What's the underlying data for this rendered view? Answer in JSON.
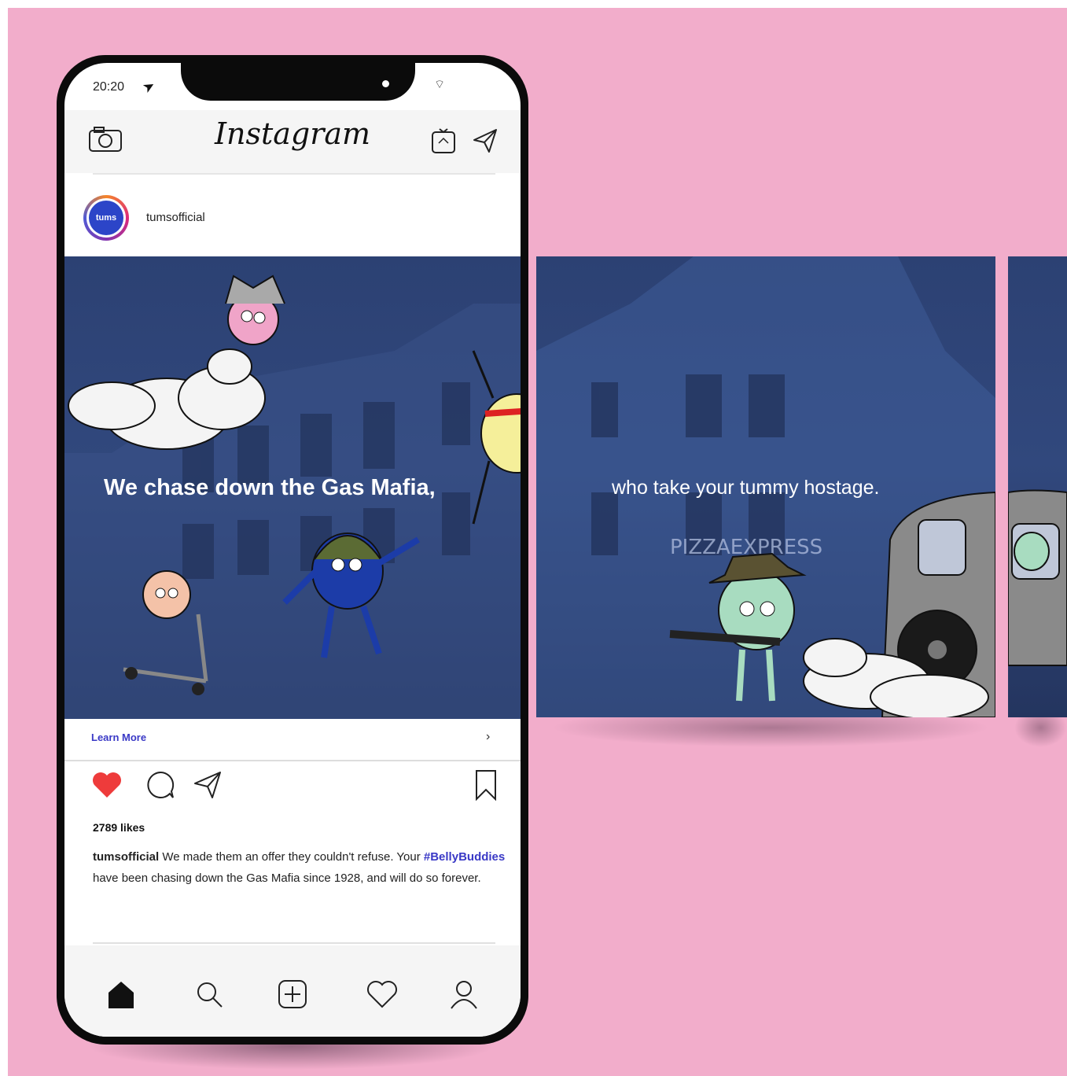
{
  "status_bar": {
    "time": "20:20"
  },
  "header": {
    "logo": "Instagram"
  },
  "post": {
    "username": "tumsofficial",
    "avatar_text": "tums",
    "slide1_caption": "We chase down the Gas Mafia,",
    "learn_more": "Learn More",
    "likes": "2789 likes",
    "caption_user": "tumsofficial",
    "caption_part1": " We made them an offer they couldn't refuse. Your ",
    "caption_hashtag": "#BellyBuddies",
    "caption_part2": " have been chasing down the Gas Mafia since 1928, and will do so forever."
  },
  "slides": {
    "slide2_caption": "who take your tummy hostage.",
    "slide2_sign": "PIZZAEXPRESS"
  },
  "colors": {
    "background": "#f2adcb",
    "accent_link": "#3a39c6",
    "like_red": "#ee3b3b",
    "slide_blue": "#2c4173"
  },
  "icons": [
    "camera-icon",
    "igtv-icon",
    "direct-message-icon",
    "heart-icon",
    "comment-icon",
    "share-icon",
    "bookmark-icon",
    "home-icon",
    "search-icon",
    "add-post-icon",
    "activity-heart-icon",
    "profile-icon",
    "chevron-right-icon",
    "location-arrow-icon",
    "wifi-icon"
  ]
}
